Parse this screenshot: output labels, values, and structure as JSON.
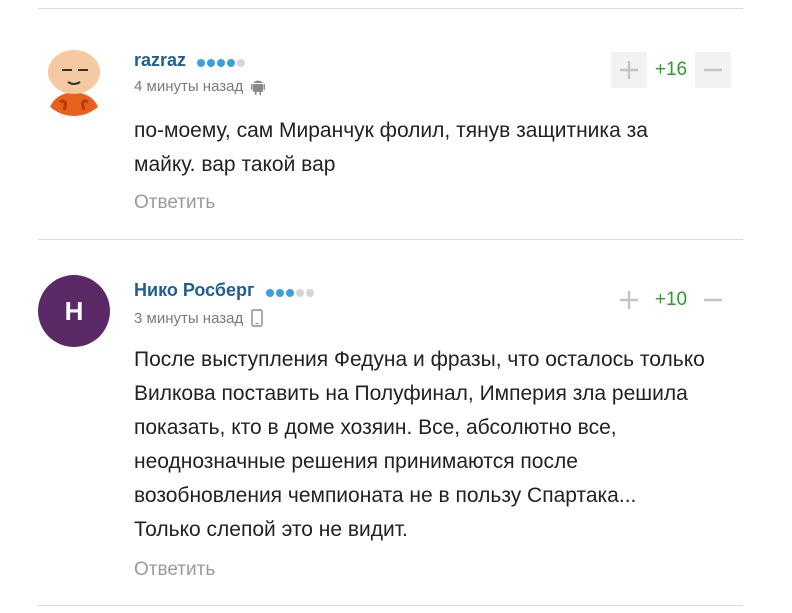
{
  "comments": [
    {
      "author": "razraz",
      "time": "4 минуты назад",
      "device_icon": "android-icon",
      "rating_dots": [
        true,
        true,
        true,
        true,
        false
      ],
      "text_lines": [
        "по-моему, сам Миранчук фолил, тянув защитника за",
        "майку. вар такой вар"
      ],
      "reply_label": "Ответить",
      "score": "+16",
      "avatar_icon": "cartoon-avatar-icon"
    },
    {
      "author": "Нико Росберг",
      "time": "3 минуты назад",
      "device_icon": "mobile-phone-icon",
      "rating_dots": [
        true,
        true,
        true,
        false,
        false
      ],
      "avatar_letter": "Н",
      "text_lines": [
        "После выступления Федуна и фразы, что осталось только",
        "Вилкова поставить на Полуфинал, Империя зла решила",
        "показать, кто в доме хозяин. Все, абсолютно все,",
        "неоднозначные решения принимаются после",
        "возобновления чемпионата не в пользу Спартака...",
        "Только слепой это не видит."
      ],
      "reply_label": "Ответить",
      "score": "+10"
    }
  ],
  "colors": {
    "author": "#1f5f8f",
    "score": "#2e9b2e",
    "dot_on": "#3aa0e0",
    "avatar_bg": "#5b2a66"
  }
}
